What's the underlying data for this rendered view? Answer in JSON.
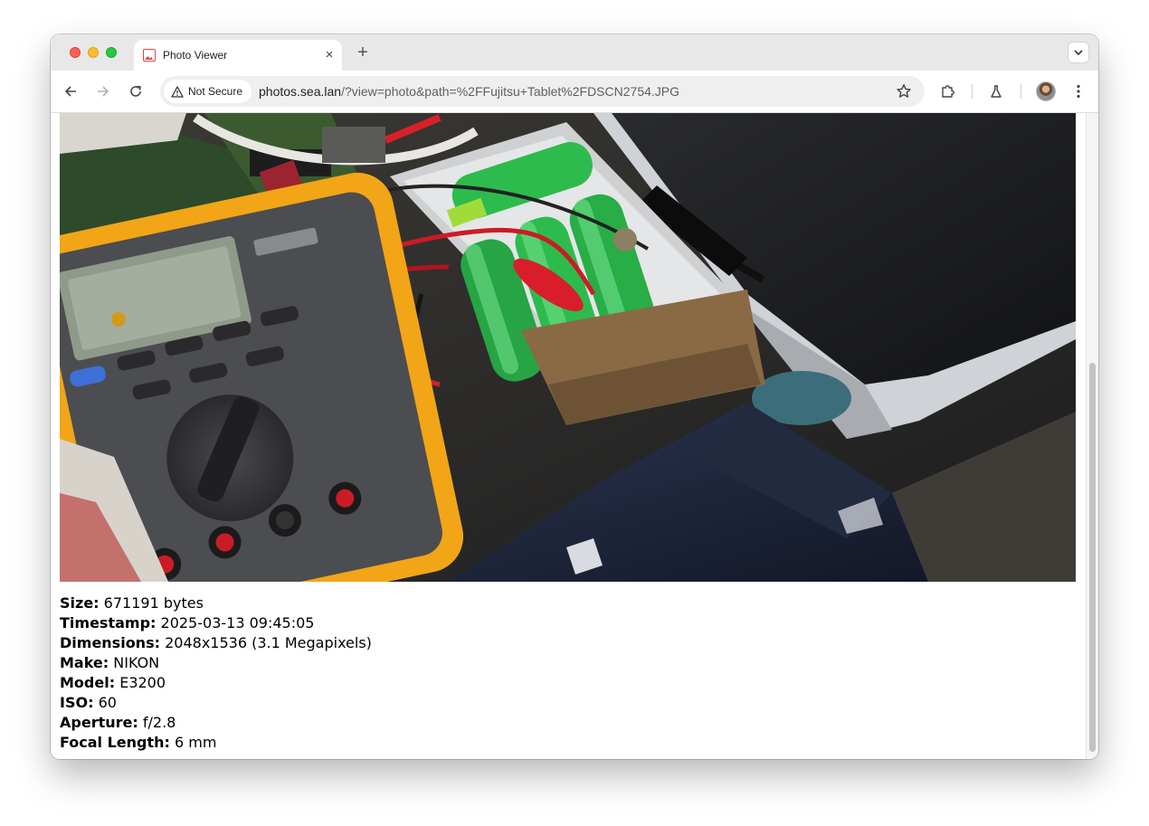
{
  "tab": {
    "title": "Photo Viewer",
    "close_glyph": "×",
    "favicon": "photo-favicon-icon"
  },
  "new_tab_glyph": "+",
  "toolbar": {
    "security_label": "Not Secure",
    "url_host": "photos.sea.lan",
    "url_path": "/?view=photo&path=%2FFujitsu+Tablet%2FDSCN2754.JPG"
  },
  "photo": {
    "alt": "DSCN2754.JPG"
  },
  "metadata": [
    {
      "key": "Size:",
      "value": "671191 bytes"
    },
    {
      "key": "Timestamp:",
      "value": "2025-03-13 09:45:05"
    },
    {
      "key": "Dimensions:",
      "value": "2048x1536 (3.1 Megapixels)"
    },
    {
      "key": "Make:",
      "value": "NIKON"
    },
    {
      "key": "Model:",
      "value": "E3200"
    },
    {
      "key": "ISO:",
      "value": "60"
    },
    {
      "key": "Aperture:",
      "value": "f/2.8"
    },
    {
      "key": "Focal Length:",
      "value": "6 mm"
    }
  ],
  "colors": {
    "multimeter_body": "#f2a516",
    "battery_green": "#2dbb4d",
    "laptop_dark": "#1d1e20"
  }
}
